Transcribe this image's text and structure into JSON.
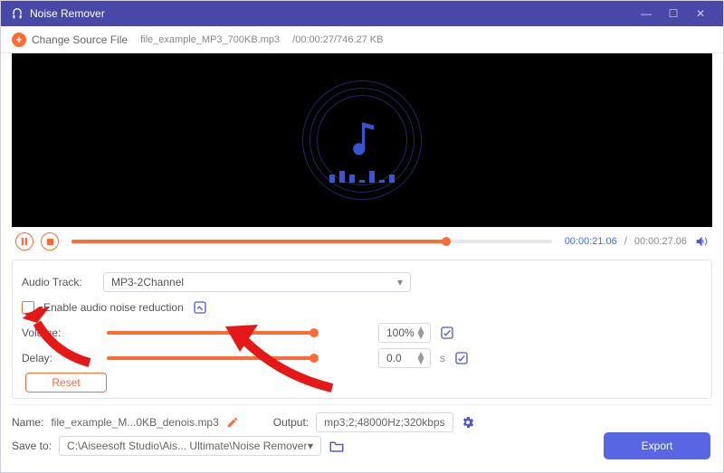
{
  "titlebar": {
    "title": "Noise Remover"
  },
  "topbar": {
    "change_source": "Change Source File",
    "filename": "file_example_MP3_700KB.mp3",
    "fileinfo": "/00:00:27/746.27 KB"
  },
  "player": {
    "current": "00:00:21.06",
    "total": "00:00:27.06",
    "progress_pct": 78
  },
  "panel": {
    "audio_track_label": "Audio Track:",
    "audio_track_value": "MP3-2Channel",
    "enable_noise_label": "Enable audio noise reduction",
    "volume_label": "Volume:",
    "volume_value": "100%",
    "delay_label": "Delay:",
    "delay_value": "0.0",
    "delay_unit": "s",
    "reset": "Reset"
  },
  "bottom": {
    "name_label": "Name:",
    "name_value": "file_example_M...0KB_denois.mp3",
    "output_label": "Output:",
    "output_value": "mp3;2;48000Hz;320kbps",
    "save_label": "Save to:",
    "save_value": "C:\\Aiseesoft Studio\\Ais... Ultimate\\Noise Remover",
    "export": "Export"
  }
}
